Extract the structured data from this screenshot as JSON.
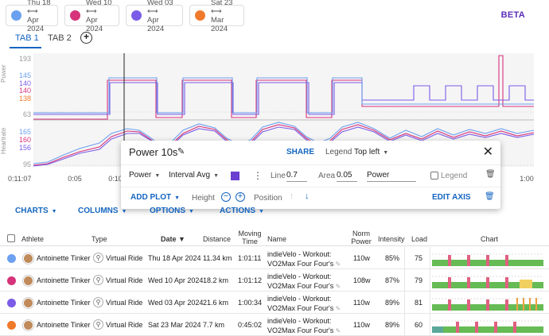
{
  "activities": [
    {
      "line1": "Thu 18 ⟷",
      "line2": "Apr 2024",
      "color": "#6ca0f0"
    },
    {
      "line1": "Wed 10 ⟷",
      "line2": "Apr 2024",
      "color": "#d6337a"
    },
    {
      "line1": "Wed 03 ⟷",
      "line2": "Apr 2024",
      "color": "#7b5ce8"
    },
    {
      "line1": "Sat 23 ⟷",
      "line2": "Mar 2024",
      "color": "#f07a2c"
    }
  ],
  "beta_label": "BETA",
  "tabs": [
    {
      "label": "TAB 1"
    },
    {
      "label": "TAB 2"
    }
  ],
  "add_tab_icon": "plus-circle-icon",
  "chart": {
    "power_axis_label": "Power",
    "power_ticks": {
      "top": "193",
      "blue": "145",
      "purple": "140",
      "red": "140",
      "orange": "138",
      "low": "63"
    },
    "heart_axis_label": "Heartrate",
    "heart_ticks": {
      "blue": "165",
      "red": "160",
      "purple": "156",
      "low": "95"
    },
    "time_ticks": [
      "0:11:07",
      "0:05",
      "0:10",
      "1:00"
    ]
  },
  "popup": {
    "title": "Power 10s",
    "share": "SHARE",
    "legend_label": "Legend",
    "legend_value": "Top left",
    "metric": "Power",
    "aggregation": "Interval Avg",
    "color": "#6a3fd1",
    "line_label": "Line",
    "line_value": "0.7",
    "area_label": "Area",
    "area_value": "0.05",
    "name_value": "Power",
    "legend_checkbox_label": "Legend",
    "add_plot": "ADD PLOT",
    "height_label": "Height",
    "position_label": "Position",
    "edit_axis": "EDIT AXIS"
  },
  "toolbar": {
    "charts": "CHARTS",
    "columns": "COLUMNS",
    "options": "OPTIONS",
    "actions": "ACTIONS"
  },
  "table": {
    "headers": {
      "athlete": "Athlete",
      "type": "Type",
      "date": "Date ▼",
      "distance": "Distance",
      "moving_time_1": "Moving",
      "moving_time_2": "Time",
      "name": "Name",
      "norm_power_1": "Norm",
      "norm_power_2": "Power",
      "intensity": "Intensity",
      "load": "Load",
      "chart": "Chart"
    },
    "rows": [
      {
        "color": "#6ca0f0",
        "athlete": "Antoinette Tinker",
        "type": "Virtual Ride",
        "date": "Thu 18 Apr 2024",
        "distance": "11.34 km",
        "time": "1:01:11",
        "name1": "indieVelo - Workout:",
        "name2": "VO2Max Four Four's",
        "power": "110w",
        "intensity": "85%",
        "load": "75"
      },
      {
        "color": "#d6337a",
        "athlete": "Antoinette Tinker",
        "type": "Virtual Ride",
        "date": "Wed 10 Apr 2024",
        "distance": "18.2 km",
        "time": "1:01:12",
        "name1": "indieVelo - Workout:",
        "name2": "VO2Max Four Four's",
        "power": "108w",
        "intensity": "87%",
        "load": "79"
      },
      {
        "color": "#7b5ce8",
        "athlete": "Antoinette Tinker",
        "type": "Virtual Ride",
        "date": "Wed 03 Apr 2024",
        "distance": "21.6 km",
        "time": "1:00:34",
        "name1": "indieVelo - Workout:",
        "name2": "VO2Max Four Four's",
        "power": "110w",
        "intensity": "89%",
        "load": "81"
      },
      {
        "color": "#f07a2c",
        "athlete": "Antoinette Tinker",
        "type": "Virtual Ride",
        "date": "Sat 23 Mar 2024",
        "distance": "7.7 km",
        "time": "0:45:02",
        "name1": "indieVelo - Workout:",
        "name2": "VO2Max Four Four's",
        "power": "110w",
        "intensity": "89%",
        "load": "60"
      }
    ]
  }
}
